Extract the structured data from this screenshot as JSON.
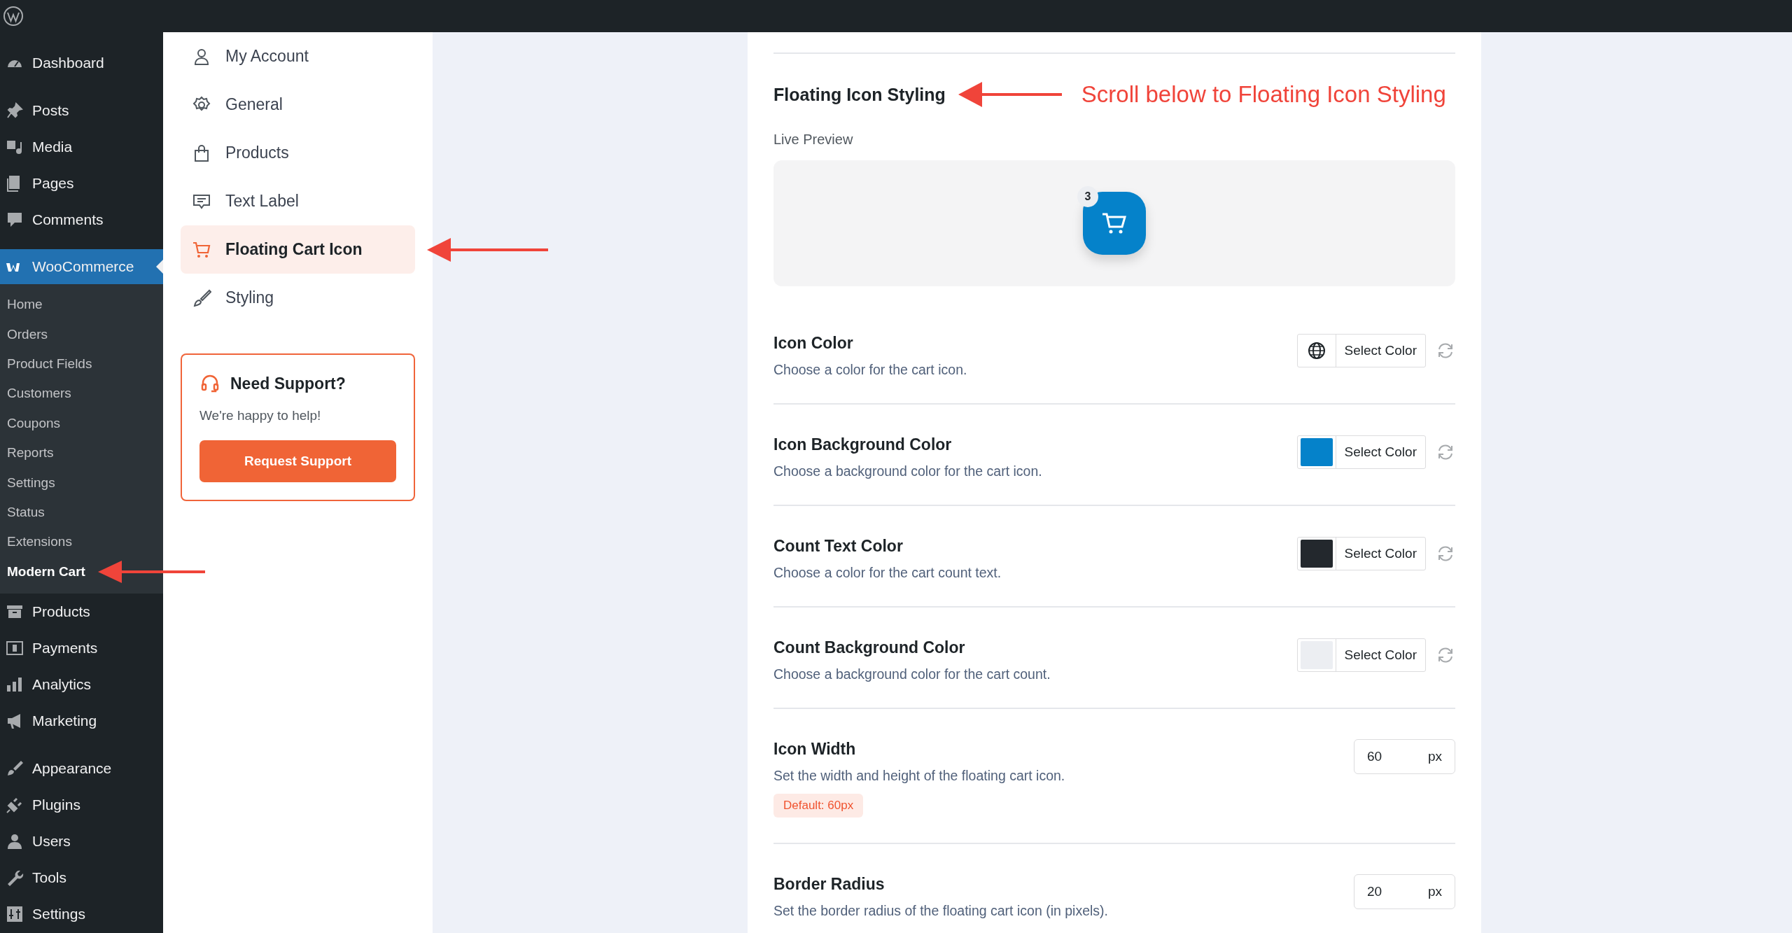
{
  "admin_menu": {
    "items": [
      {
        "label": "Dashboard",
        "selected": false
      },
      {
        "label": "Posts",
        "selected": false
      },
      {
        "label": "Media",
        "selected": false
      },
      {
        "label": "Pages",
        "selected": false
      },
      {
        "label": "Comments",
        "selected": false
      },
      {
        "label": "WooCommerce",
        "selected": true,
        "children": [
          {
            "label": "Home",
            "selected": false
          },
          {
            "label": "Orders",
            "selected": false
          },
          {
            "label": "Product Fields",
            "selected": false
          },
          {
            "label": "Customers",
            "selected": false
          },
          {
            "label": "Coupons",
            "selected": false
          },
          {
            "label": "Reports",
            "selected": false
          },
          {
            "label": "Settings",
            "selected": false
          },
          {
            "label": "Status",
            "selected": false
          },
          {
            "label": "Extensions",
            "selected": false
          },
          {
            "label": "Modern Cart",
            "selected": true,
            "annotated": true
          }
        ]
      },
      {
        "label": "Products",
        "selected": false
      },
      {
        "label": "Payments",
        "selected": false
      },
      {
        "label": "Analytics",
        "selected": false
      },
      {
        "label": "Marketing",
        "selected": false
      },
      {
        "label": "Appearance",
        "selected": false
      },
      {
        "label": "Plugins",
        "selected": false
      },
      {
        "label": "Users",
        "selected": false
      },
      {
        "label": "Tools",
        "selected": false
      },
      {
        "label": "Settings",
        "selected": false
      }
    ]
  },
  "settings_nav": {
    "items": [
      {
        "label": "My Account",
        "selected": false
      },
      {
        "label": "General",
        "selected": false
      },
      {
        "label": "Products",
        "selected": false
      },
      {
        "label": "Text Label",
        "selected": false
      },
      {
        "label": "Floating Cart Icon",
        "selected": true,
        "annotated": true
      },
      {
        "label": "Styling",
        "selected": false
      }
    ],
    "support": {
      "title": "Need Support?",
      "text": "We're happy to help!",
      "button": "Request Support"
    }
  },
  "section": {
    "title": "Floating Icon Styling",
    "annotation": "Scroll below to Floating Icon Styling",
    "preview_label": "Live Preview",
    "preview": {
      "count": "3"
    },
    "settings": [
      {
        "kind": "color",
        "label": "Icon Color",
        "description": "Choose a color for the cart icon.",
        "button": "Select Color"
      },
      {
        "kind": "color",
        "label": "Icon Background Color",
        "description": "Choose a background color for the cart icon.",
        "color": "#0582ca",
        "button": "Select Color"
      },
      {
        "kind": "color",
        "label": "Count Text Color",
        "description": "Choose a color for the cart count text.",
        "color": "#23282d",
        "button": "Select Color"
      },
      {
        "kind": "color",
        "label": "Count Background Color",
        "description": "Choose a background color for the cart count.",
        "color": "#eceef2",
        "button": "Select Color"
      },
      {
        "kind": "number",
        "label": "Icon Width",
        "description": "Set the width and height of the floating cart icon.",
        "value": "60",
        "unit": "px",
        "default": "Default: 60px"
      },
      {
        "kind": "number",
        "label": "Border Radius",
        "description": "Set the border radius of the floating cart icon (in pixels).",
        "value": "20",
        "unit": "px"
      }
    ]
  }
}
